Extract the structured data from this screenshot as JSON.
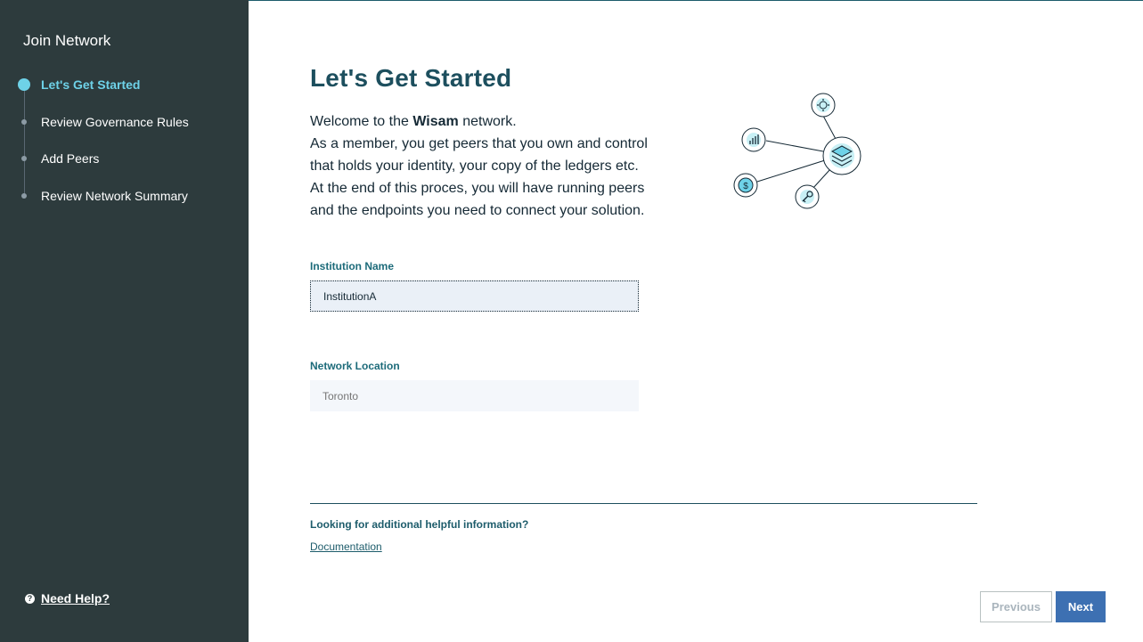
{
  "sidebar": {
    "title": "Join Network",
    "steps": [
      {
        "label": "Let's Get Started",
        "active": true
      },
      {
        "label": "Review Governance Rules",
        "active": false
      },
      {
        "label": "Add Peers",
        "active": false
      },
      {
        "label": "Review Network Summary",
        "active": false
      }
    ],
    "help_icon": "question-icon",
    "help_label": "Need Help?"
  },
  "main": {
    "title": "Let's Get Started",
    "intro": {
      "prefix": "Welcome to the ",
      "network_name": "Wisam",
      "suffix": " network.",
      "lines": [
        "As a member, you get peers that you own and control",
        "that holds your identity, your copy of the ledgers etc.",
        "At the end of this proces, you will have running peers",
        "and the endpoints you need to connect your solution."
      ]
    },
    "illustration_icons": [
      "gear-icon",
      "bar-chart-icon",
      "layers-icon",
      "dollar-icon",
      "key-icon"
    ],
    "fields": {
      "institution_label": "Institution Name",
      "institution_value": "InstitutionA",
      "location_label": "Network Location",
      "location_value": "Toronto"
    },
    "help_section": {
      "heading": "Looking for additional helpful information?",
      "doc_link": "Documentation"
    }
  },
  "footer": {
    "previous_label": "Previous",
    "next_label": "Next"
  },
  "colors": {
    "sidebar_bg": "#2d3b3d",
    "active_step": "#6ed2e8",
    "title": "#1d4f5e",
    "primary_button": "#3d70b2"
  }
}
